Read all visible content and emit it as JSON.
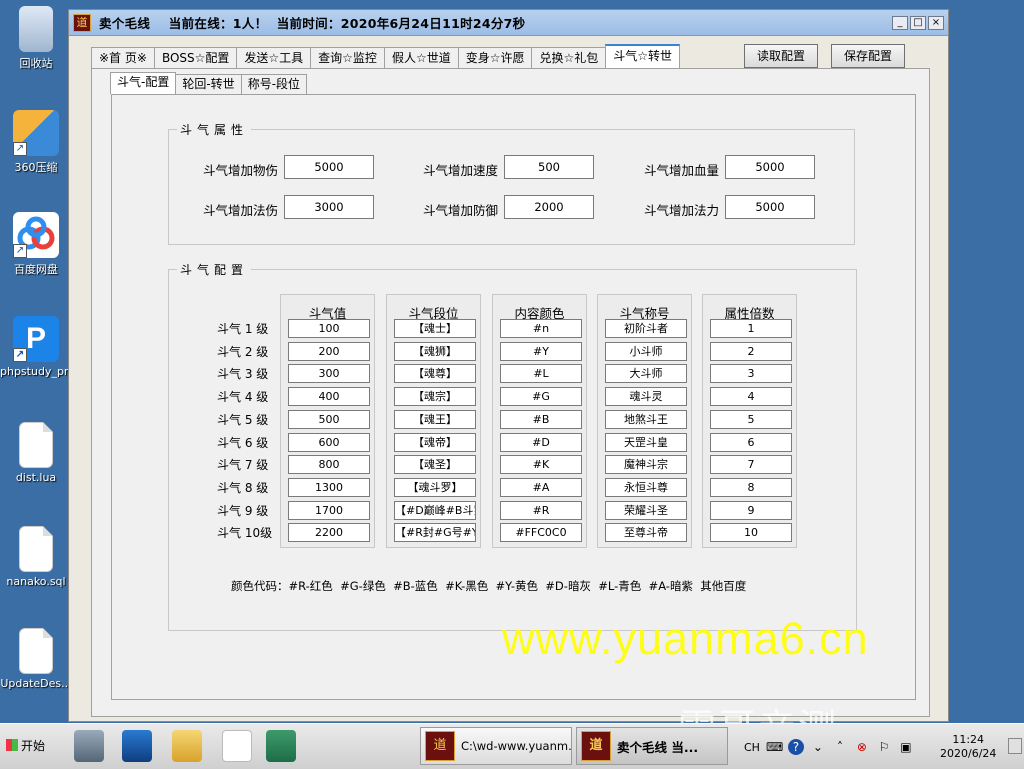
{
  "desktop": {
    "icons": [
      {
        "label": "回收站"
      },
      {
        "label": "360压缩"
      },
      {
        "label": "百度网盘"
      },
      {
        "label": "phpstudy_pro"
      },
      {
        "label": "dist.lua"
      },
      {
        "label": "nanako.sql"
      },
      {
        "label": "UpdateDes..."
      }
    ]
  },
  "window": {
    "title": "卖个毛线    当前在线：1人！  当前时间：2020年6月24日11时24分7秒",
    "controls": {
      "min": "_",
      "max": "□",
      "close": "×"
    },
    "tabs": [
      "※首 页※",
      "BOSS☆配置",
      "发送☆工具",
      "查询☆监控",
      "假人☆世道",
      "变身☆许愿",
      "兑换☆礼包",
      "斗气☆转世"
    ],
    "active_tab": "斗气☆转世",
    "read_button": "读取配置",
    "save_button": "保存配置",
    "subtabs": [
      "斗气-配置",
      "轮回-转世",
      "称号-段位"
    ],
    "active_subtab": "斗气-配置",
    "attr_group": {
      "title": "斗气属性",
      "fields": [
        {
          "label": "斗气增加物伤",
          "value": "5000"
        },
        {
          "label": "斗气增加速度",
          "value": "500"
        },
        {
          "label": "斗气增加血量",
          "value": "5000"
        },
        {
          "label": "斗气增加法伤",
          "value": "3000"
        },
        {
          "label": "斗气增加防御",
          "value": "2000"
        },
        {
          "label": "斗气增加法力",
          "value": "5000"
        }
      ]
    },
    "config_group": {
      "title": "斗气配置",
      "columns": [
        "斗气值",
        "斗气段位",
        "内容颜色",
        "斗气称号",
        "属性倍数"
      ],
      "row_labels": [
        "斗气 1 级",
        "斗气 2 级",
        "斗气 3 级",
        "斗气 4 级",
        "斗气 5 级",
        "斗气 6 级",
        "斗气 7 级",
        "斗气 8 级",
        "斗气 9 级",
        "斗气 10级"
      ],
      "values": [
        "100",
        "200",
        "300",
        "400",
        "500",
        "600",
        "800",
        "1300",
        "1700",
        "2200"
      ],
      "ranks": [
        "【魂士】",
        "【魂狮】",
        "【魂尊】",
        "【魂宗】",
        "【魂王】",
        "【魂帝】",
        "【魂圣】",
        "【魂斗罗】",
        "【#D巅峰#B斗罗",
        "【#R封#G号#Y斗"
      ],
      "colors": [
        "#n",
        "#Y",
        "#L",
        "#G",
        "#B",
        "#D",
        "#K",
        "#A",
        "#R",
        "#FFC0C0"
      ],
      "titles": [
        "初阶斗者",
        "小斗师",
        "大斗师",
        "魂斗灵",
        "地煞斗王",
        "天罡斗皇",
        "魔神斗宗",
        "永恒斗尊",
        "荣耀斗圣",
        "至尊斗帝"
      ],
      "multipliers": [
        "1",
        "2",
        "3",
        "4",
        "5",
        "6",
        "7",
        "8",
        "9",
        "10"
      ],
      "legend": "颜色代码：#R-红色  #G-绿色  #B-蓝色  #K-黑色  #Y-黄色  #D-暗灰  #L-青色  #A-暗紫  其他百度"
    }
  },
  "watermark": {
    "site": "www.yuanma6.cn",
    "note": "雷哥亲测"
  },
  "taskbar": {
    "start_label": "开始",
    "tasks": [
      {
        "label": "C:\\wd-www.yuanm..."
      },
      {
        "label": "卖个毛线   当..."
      }
    ],
    "tray_lang": "CH",
    "clock_time": "11:24",
    "clock_date": "2020/6/24"
  }
}
